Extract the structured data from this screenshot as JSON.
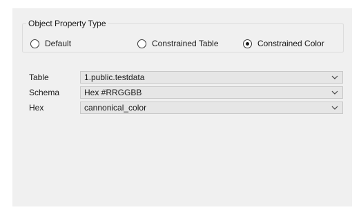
{
  "object_property_type": {
    "title": "Object Property Type",
    "options": [
      {
        "label": "Default",
        "checked": false
      },
      {
        "label": "Constrained Table",
        "checked": false
      },
      {
        "label": "Constrained Color",
        "checked": true
      }
    ]
  },
  "fields": [
    {
      "label": "Table",
      "value": "1.public.testdata"
    },
    {
      "label": "Schema",
      "value": "Hex #RRGGBB"
    },
    {
      "label": "Hex",
      "value": "cannonical_color"
    }
  ],
  "icons": {
    "dropdown": "chevron-down-icon"
  }
}
